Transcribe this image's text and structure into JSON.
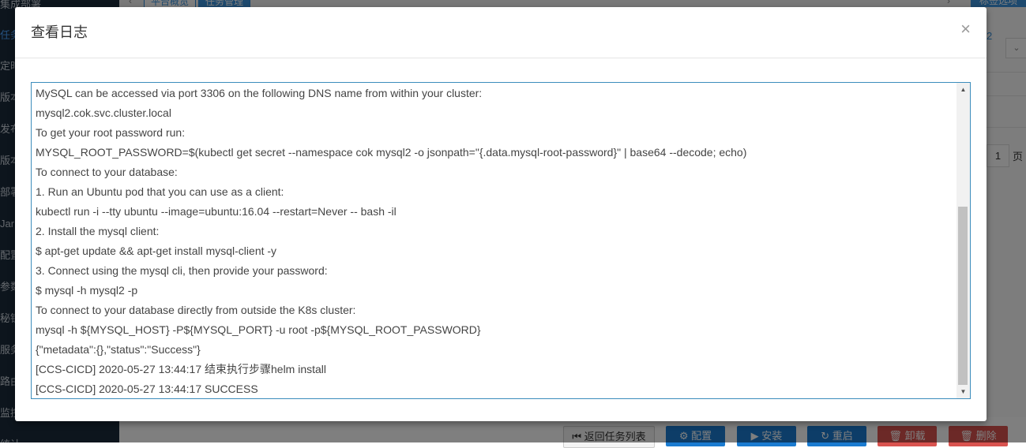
{
  "sidebar": {
    "items": [
      {
        "label": "集成部署"
      },
      {
        "label": "任务"
      },
      {
        "label": "定时"
      },
      {
        "label": "版本"
      },
      {
        "label": "发布"
      },
      {
        "label": "版本"
      },
      {
        "label": "部署"
      },
      {
        "label": "Jar"
      },
      {
        "label": "配置"
      },
      {
        "label": "参数"
      },
      {
        "label": "秘钥"
      },
      {
        "label": "服务"
      },
      {
        "label": "路由"
      },
      {
        "label": "监控"
      },
      {
        "label": "统计"
      }
    ]
  },
  "tabs": {
    "items": [
      {
        "label": "平台概览"
      },
      {
        "label": "任务管理"
      }
    ],
    "tag_options_label": "标签选项"
  },
  "right_panel": {
    "link_text": "2",
    "page_value": "1",
    "page_unit": "页"
  },
  "bottom_buttons": {
    "back": "返回任务列表",
    "config": "配置",
    "install": "安装",
    "restart": "重启",
    "uninstall": "卸载",
    "delete": "删除"
  },
  "modal": {
    "title": "查看日志",
    "close_symbol": "×",
    "log_lines": [
      "MySQL can be accessed via port 3306 on the following DNS name from within your cluster:",
      "mysql2.cok.svc.cluster.local",
      "To get your root password run:",
      "MYSQL_ROOT_PASSWORD=$(kubectl get secret --namespace cok mysql2 -o jsonpath=\"{.data.mysql-root-password}\" | base64 --decode; echo)",
      "To connect to your database:",
      "1. Run an Ubuntu pod that you can use as a client:",
      "kubectl run -i --tty ubuntu --image=ubuntu:16.04 --restart=Never -- bash -il",
      "2. Install the mysql client:",
      "$ apt-get update && apt-get install mysql-client -y",
      "3. Connect using the mysql cli, then provide your password:",
      "$ mysql -h mysql2 -p",
      "To connect to your database directly from outside the K8s cluster:",
      "mysql -h ${MYSQL_HOST} -P${MYSQL_PORT} -u root -p${MYSQL_ROOT_PASSWORD}",
      "{\"metadata\":{},\"status\":\"Success\"}",
      "[CCS-CICD] 2020-05-27 13:44:17 结束执行步骤helm install",
      "[CCS-CICD] 2020-05-27 13:44:17 SUCCESS"
    ]
  }
}
